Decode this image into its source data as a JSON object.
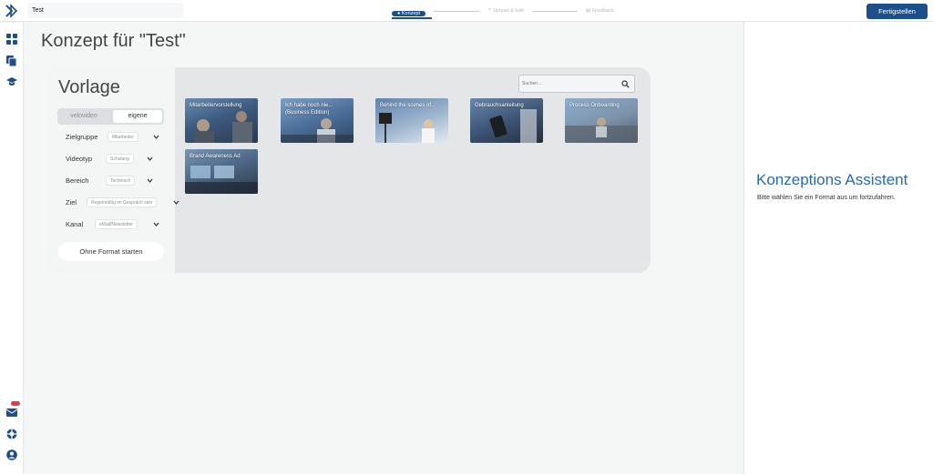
{
  "topbar": {
    "project_name": "Test",
    "steps": [
      {
        "label": "Konzept",
        "state": "active"
      },
      {
        "label": "Upload & Edit",
        "state": "pending"
      },
      {
        "label": "Feedback",
        "state": "pending"
      }
    ],
    "finish_label": "Fertigstellen"
  },
  "sidebar": {
    "icons": [
      "dashboard-icon",
      "copy-icon",
      "graduation-cap-icon",
      "mail-icon",
      "support-icon",
      "user-icon"
    ]
  },
  "page": {
    "title": "Konzept für \"Test\""
  },
  "vorlage": {
    "title": "Vorlage",
    "toggle": {
      "option_a": "velovideo",
      "option_b": "eigene",
      "selected": "eigene"
    },
    "filters": [
      {
        "label": "Zielgruppe",
        "value": "Mitarbeiter"
      },
      {
        "label": "Videotyp",
        "value": "Schulung"
      },
      {
        "label": "Bereich",
        "value": "Technisch"
      },
      {
        "label": "Ziel",
        "value": "Regelmäßig im Gespräch sein"
      },
      {
        "label": "Kanal",
        "value": "eMail/Newsletter"
      }
    ],
    "start_without_format": "Ohne Format starten",
    "search_placeholder": "Suchen..."
  },
  "templates": [
    {
      "title": "Mitarbeitervorstellung"
    },
    {
      "title": "Ich habe noch nie... (Business Edition)"
    },
    {
      "title": "Behind the scenes of..."
    },
    {
      "title": "Gebrauchsanleitung"
    },
    {
      "title": "Process Onboarding"
    },
    {
      "title": "Brand Awareness Ad"
    }
  ],
  "assistant": {
    "title": "Konzeptions Assistent",
    "subtitle": "Bitte wählen Sie ein Format aus um fortzufahren."
  },
  "colors": {
    "accent": "#1d4f8b",
    "assistant_title": "#2a6ab0",
    "badge": "#e63946"
  }
}
